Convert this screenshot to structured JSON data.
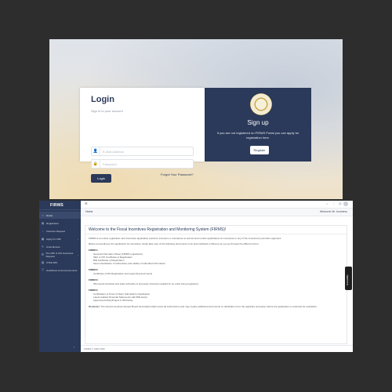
{
  "login": {
    "title": "Login",
    "subtitle": "Sign in to your account",
    "email_placeholder": "E-Mail Address",
    "password_placeholder": "Password",
    "login_button": "Login",
    "forgot_link": "Forgot Your Password?",
    "email_icon": "user-icon",
    "password_icon": "lock-icon"
  },
  "signup": {
    "title": "Sign up",
    "text": "If you are not registered on FIRMS Portal you can apply for registration here.",
    "register_button": "Register"
  },
  "app": {
    "logo": "FIRMS",
    "sidebar": {
      "items": [
        {
          "label": "Home",
          "icon": "home-icon",
          "active": true
        },
        {
          "label": "Registration",
          "icon": "clipboard-icon"
        },
        {
          "label": "Incentive Request",
          "icon": "file-icon"
        },
        {
          "label": "Apply for CRF",
          "icon": "form-icon",
          "has_children": true
        },
        {
          "label": "Amendments",
          "icon": "edit-icon"
        },
        {
          "label": "Pre CRF & CIS Incentives Request",
          "icon": "list-icon",
          "has_children": true
        },
        {
          "label": "OTFE MIS",
          "icon": "chart-icon"
        },
        {
          "label": "Guidelines & Announcements",
          "icon": "info-icon"
        }
      ]
    },
    "breadcrumb": "Home",
    "welcome": "Welcome Mr. business",
    "content_title": "Welcome to the Fiscal Incentives Registration and Monitoring System (FIRMS)!",
    "intro_1": "FIRMS is an online registration and incentives application portal for investors or enterprises to submit and monitor applications for incentives in any of the investment promotion agencies.",
    "intro_2": "Before proceeding to the application for incentives, kindly take note of the following documents to be accomplished or filled up as you go through the different forms:",
    "sections": [
      {
        "heading": "FORM 1:",
        "items": [
          "General Information Sheet (FIRMS registration)",
          "SEC or DTI Certificate of Registration",
          "BIR Certificate of Registration",
          "Sworn declaration of authenticity and validity of submitted information"
        ]
      },
      {
        "heading": "FORM 2:",
        "items": [
          "Certificate of IPA Registration and supporting documents"
        ]
      },
      {
        "heading": "FORM 3:",
        "items": [
          "IPA-issued schedule and sales schedule of proposed incentives availed for an entity being registered"
        ]
      },
      {
        "heading": "FORM 4:",
        "items": [
          "Certification of Proof of Claim Submittal for Application",
          "Latest Audited Financial Statements with BIR stamp",
          "Approved Activity/Project in IPA listing"
        ]
      }
    ],
    "reminder_label": "Reminder:",
    "reminder_text": "The Fiscal Incentives Review Board Secretariat shall review all submissions and may require additional documents or clarification from the applicant enterprise before the application is endorsed for evaluation.",
    "side_tab": "Accessibility",
    "footer": "FIRMS © 2023 DOF"
  }
}
